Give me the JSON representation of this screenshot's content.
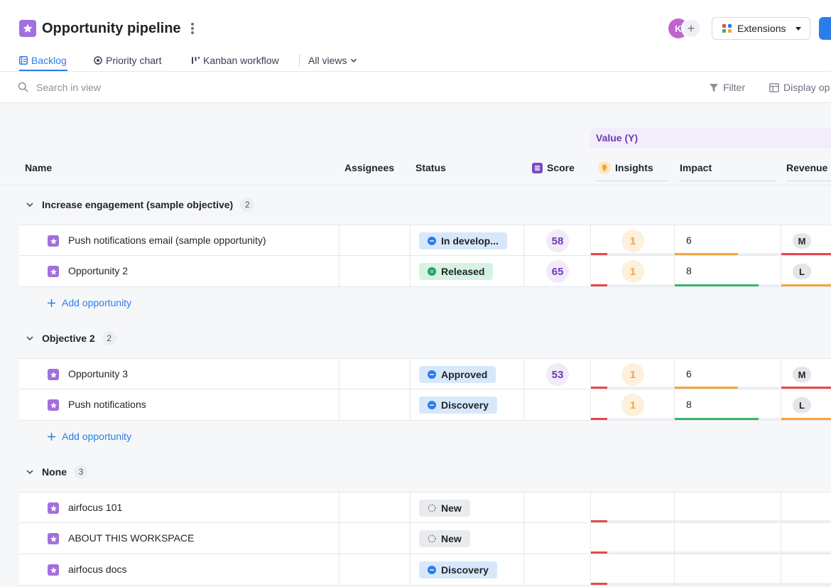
{
  "header": {
    "title": "Opportunity pipeline",
    "avatar_initial": "K",
    "add_member_symbol": "+",
    "extensions_label": "Extensions"
  },
  "tabs": [
    {
      "label": "Backlog",
      "icon": "list-icon",
      "active": true
    },
    {
      "label": "Priority chart",
      "icon": "target-icon",
      "active": false
    },
    {
      "label": "Kanban workflow",
      "icon": "kanban-icon",
      "active": false
    },
    {
      "label": "All views",
      "icon": "chevron-down-icon",
      "active": false
    }
  ],
  "toolbar": {
    "search_placeholder": "Search in view",
    "filter_label": "Filter",
    "display_label": "Display op"
  },
  "columns": {
    "group_label": "Value (Y)",
    "name": "Name",
    "assignees": "Assignees",
    "status": "Status",
    "score": "Score",
    "insights": "Insights",
    "impact": "Impact",
    "revenue": "Revenue"
  },
  "groups": [
    {
      "title": "Increase engagement (sample objective)",
      "count": "2",
      "add_label": "Add opportunity",
      "rows": [
        {
          "name": "Push notifications email (sample opportunity)",
          "status": "In develop...",
          "status_style": "blue",
          "score": "58",
          "insights": "1",
          "impact": "6",
          "impact_level": 0.6,
          "impact_color": "#f5a540",
          "revenue": "M",
          "revenue_level": 1.0,
          "revenue_color": "#e5484d"
        },
        {
          "name": "Opportunity 2",
          "status": "Released",
          "status_style": "green",
          "score": "65",
          "insights": "1",
          "impact": "8",
          "impact_level": 0.8,
          "impact_color": "#3cb56c",
          "revenue": "L",
          "revenue_level": 1.0,
          "revenue_color": "#f5a540"
        }
      ]
    },
    {
      "title": "Objective 2",
      "count": "2",
      "add_label": "Add opportunity",
      "rows": [
        {
          "name": "Opportunity 3",
          "status": "Approved",
          "status_style": "blue",
          "score": "53",
          "insights": "1",
          "impact": "6",
          "impact_level": 0.6,
          "impact_color": "#f5a540",
          "revenue": "M",
          "revenue_level": 1.0,
          "revenue_color": "#e5484d"
        },
        {
          "name": "Push notifications",
          "status": "Discovery",
          "status_style": "blue",
          "score": "",
          "insights": "1",
          "impact": "8",
          "impact_level": 0.8,
          "impact_color": "#3cb56c",
          "revenue": "L",
          "revenue_level": 1.0,
          "revenue_color": "#f5a540"
        }
      ]
    },
    {
      "title": "None",
      "count": "3",
      "add_label": "",
      "rows": [
        {
          "name": "airfocus 101",
          "status": "New",
          "status_style": "gray",
          "score": "",
          "insights": "",
          "impact": "",
          "impact_level": 0,
          "impact_color": "#e5484d",
          "revenue": "",
          "revenue_level": 0,
          "revenue_color": "#e5484d"
        },
        {
          "name": "ABOUT THIS WORKSPACE",
          "status": "New",
          "status_style": "gray",
          "score": "",
          "insights": "",
          "impact": "",
          "impact_level": 0,
          "impact_color": "#e5484d",
          "revenue": "",
          "revenue_level": 0,
          "revenue_color": "#e5484d"
        },
        {
          "name": "airfocus docs",
          "status": "Discovery",
          "status_style": "blue",
          "score": "",
          "insights": "",
          "impact": "",
          "impact_level": 0,
          "impact_color": "#e5484d",
          "revenue": "",
          "revenue_level": 0,
          "revenue_color": "#e5484d"
        }
      ]
    }
  ],
  "colors": {
    "accent": "#2b7de9",
    "brand_purple": "#a170de",
    "status_blue_bg": "#d8e8fb",
    "status_green_bg": "#d6f2e3",
    "status_gray_bg": "#e9ebee",
    "insight_orange": "#f2a53a",
    "low_red": "#e5484d"
  }
}
